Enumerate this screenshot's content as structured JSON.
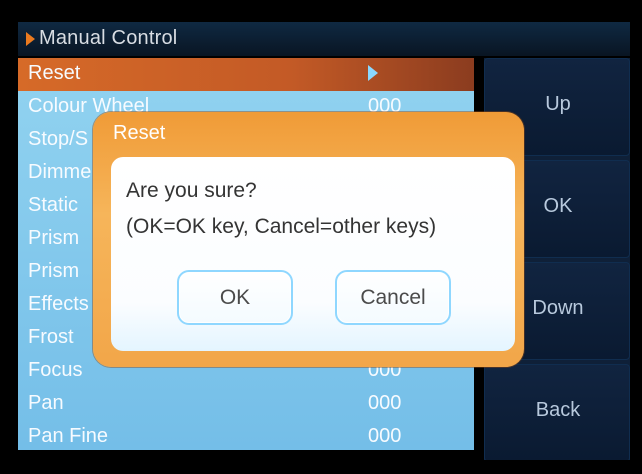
{
  "header": {
    "title": "Manual Control",
    "icon": "triangle-right-icon"
  },
  "menu": {
    "items": [
      {
        "label": "Reset",
        "value": "",
        "selected": true
      },
      {
        "label": "Colour Wheel",
        "value": "000"
      },
      {
        "label": "Stop/S",
        "value": ""
      },
      {
        "label": "Dimme",
        "value": ""
      },
      {
        "label": "Static",
        "value": ""
      },
      {
        "label": "Prism",
        "value": ""
      },
      {
        "label": "Prism",
        "value": ""
      },
      {
        "label": "Effects",
        "value": ""
      },
      {
        "label": "Frost",
        "value": ""
      },
      {
        "label": "Focus",
        "value": "000"
      },
      {
        "label": "Pan",
        "value": "000"
      },
      {
        "label": "Pan Fine",
        "value": "000"
      }
    ]
  },
  "side_buttons": [
    {
      "label": "Up"
    },
    {
      "label": "OK"
    },
    {
      "label": "Down"
    },
    {
      "label": "Back"
    }
  ],
  "dialog": {
    "title": "Reset",
    "question": "Are you sure?",
    "hint": "(OK=OK key, Cancel=other keys)",
    "ok_label": "OK",
    "cancel_label": "Cancel"
  },
  "colors": {
    "accent": "#ea7a1f",
    "menu_background": "#74bee8",
    "selected_row": "#d66a28",
    "side_panel": "#0f2038",
    "dialog_frame": "#f09b37"
  }
}
